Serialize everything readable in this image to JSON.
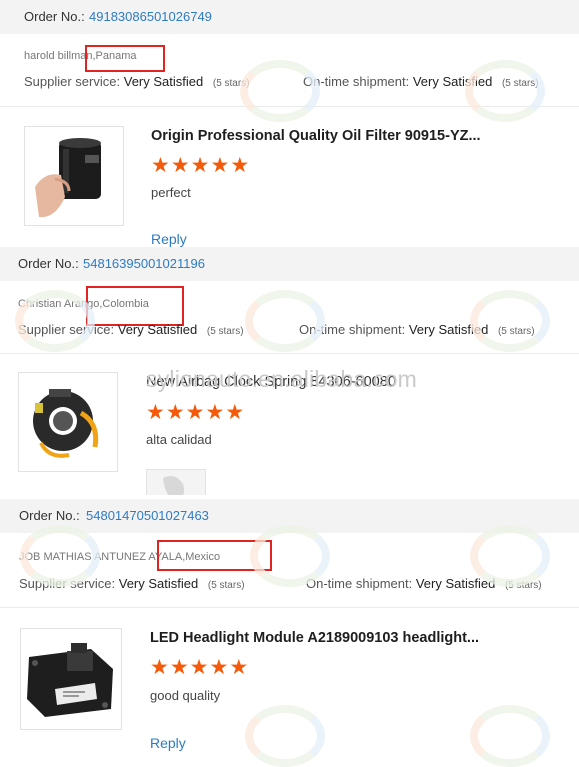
{
  "labels": {
    "order_no": "Order No.:",
    "supplier_service": "Supplier service:",
    "ontime_shipment": "On-time shipment:",
    "reply": "Reply"
  },
  "watermark_text": "sylionauto.en.alibaba.com",
  "colors": {
    "star": "#f55a0b",
    "link": "#2e7bc4",
    "highlight_box": "#e0241f"
  },
  "reviews": [
    {
      "order_number": "49183086501026749",
      "user": "harold billman,Panama",
      "supplier_service": {
        "value": "Very Satisfied",
        "stars_text": "(5 stars)"
      },
      "ontime_shipment": {
        "value": "Very Satisfied",
        "stars_text": "(5 stars)"
      },
      "product_title": "Origin Professional Quality Oil Filter 90915-YZ...",
      "rating": 5,
      "comment": "perfect",
      "thumbnail_icon": "oil-filter-photo"
    },
    {
      "order_number": "54816395001021196",
      "user": "Christian Arango,Colombia",
      "supplier_service": {
        "value": "Very Satisfied",
        "stars_text": "(5 stars)"
      },
      "ontime_shipment": {
        "value": "Very Satisfied",
        "stars_text": "(5 stars)"
      },
      "product_title": "New Airbag Clock Spring 84306-60080",
      "rating": 5,
      "comment": "alta calidad",
      "thumbnail_icon": "clock-spring-photo"
    },
    {
      "order_number": "54801470501027463",
      "user": "JOB MATHIAS ANTUNEZ AYALA,Mexico",
      "supplier_service": {
        "value": "Very Satisfied",
        "stars_text": "(5 stars)"
      },
      "ontime_shipment": {
        "value": "Very Satisfied",
        "stars_text": "(5 stars)"
      },
      "product_title": "LED Headlight Module A2189009103 headlight...",
      "rating": 5,
      "comment": "good quality",
      "thumbnail_icon": "headlight-module-photo"
    }
  ]
}
